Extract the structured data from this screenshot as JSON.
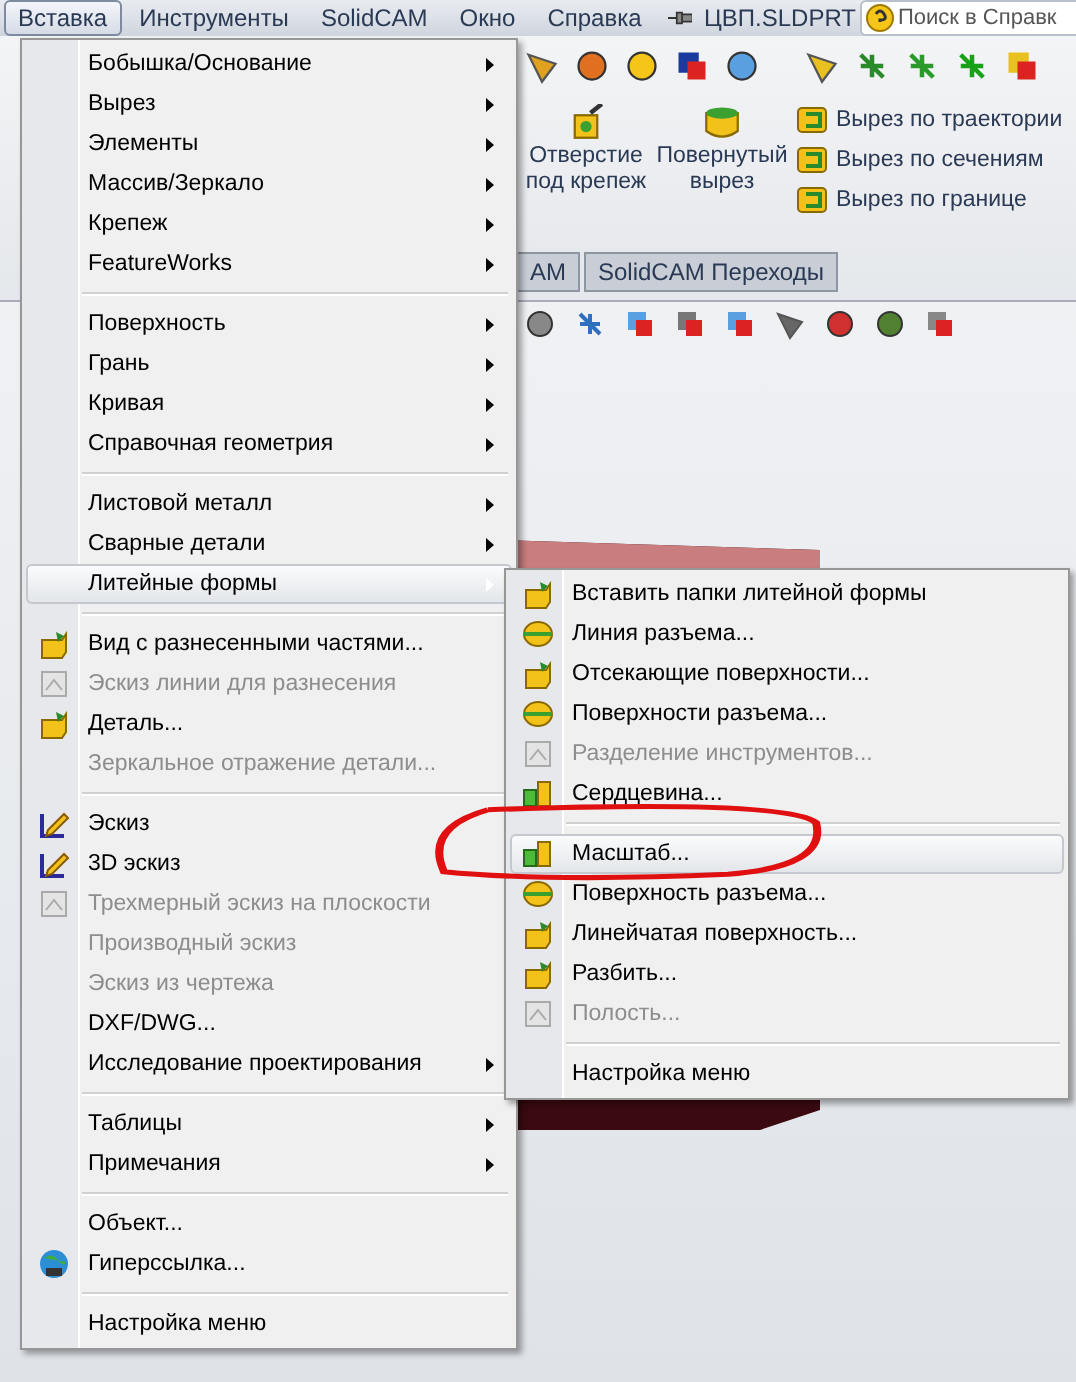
{
  "menubar": {
    "items": [
      {
        "label": "Вставка",
        "selected": true
      },
      {
        "label": "Инструменты",
        "selected": false
      },
      {
        "label": "SolidCAM",
        "selected": false
      },
      {
        "label": "Окно",
        "selected": false
      },
      {
        "label": "Справка",
        "selected": false
      }
    ]
  },
  "document_title": "ЦВП.SLDPRT",
  "search": {
    "placeholder": "Поиск в Справк"
  },
  "ribbon": {
    "buttons": [
      "Отверстие под крепеж",
      "Повернутый вырез"
    ],
    "cut_commands": [
      "Вырез по траектории",
      "Вырез по сечениям",
      "Вырез по границе"
    ]
  },
  "tabs": [
    "AM",
    "SolidCAM Переходы"
  ],
  "menu": {
    "groups": [
      [
        {
          "label": "Бобышка/Основание",
          "submenu": true,
          "disabled": false,
          "selected": false
        },
        {
          "label": "Вырез",
          "submenu": true,
          "disabled": false,
          "selected": false
        },
        {
          "label": "Элементы",
          "submenu": true,
          "disabled": false,
          "selected": false
        },
        {
          "label": "Массив/Зеркало",
          "submenu": true,
          "disabled": false,
          "selected": false
        },
        {
          "label": "Крепеж",
          "submenu": true,
          "disabled": false,
          "selected": false
        },
        {
          "label": "FeatureWorks",
          "submenu": true,
          "disabled": false,
          "selected": false
        }
      ],
      [
        {
          "label": "Поверхность",
          "submenu": true,
          "disabled": false,
          "selected": false
        },
        {
          "label": "Грань",
          "submenu": true,
          "disabled": false,
          "selected": false
        },
        {
          "label": "Кривая",
          "submenu": true,
          "disabled": false,
          "selected": false
        },
        {
          "label": "Справочная геометрия",
          "submenu": true,
          "disabled": false,
          "selected": false
        }
      ],
      [
        {
          "label": "Листовой металл",
          "submenu": true,
          "disabled": false,
          "selected": false
        },
        {
          "label": "Сварные детали",
          "submenu": true,
          "disabled": false,
          "selected": false
        },
        {
          "label": "Литейные формы",
          "submenu": true,
          "disabled": false,
          "selected": true
        }
      ],
      [
        {
          "label": "Вид с разнесенными частями...",
          "submenu": false,
          "disabled": false,
          "selected": false
        },
        {
          "label": "Эскиз линии для разнесения",
          "submenu": false,
          "disabled": true,
          "selected": false
        },
        {
          "label": "Деталь...",
          "submenu": false,
          "disabled": false,
          "selected": false
        },
        {
          "label": "Зеркальное отражение детали...",
          "submenu": false,
          "disabled": true,
          "selected": false
        }
      ],
      [
        {
          "label": "Эскиз",
          "submenu": false,
          "disabled": false,
          "selected": false
        },
        {
          "label": "3D эскиз",
          "submenu": false,
          "disabled": false,
          "selected": false
        },
        {
          "label": "Трехмерный эскиз на плоскости",
          "submenu": false,
          "disabled": true,
          "selected": false
        },
        {
          "label": "Производный эскиз",
          "submenu": false,
          "disabled": true,
          "selected": false
        },
        {
          "label": "Эскиз из чертежа",
          "submenu": false,
          "disabled": true,
          "selected": false
        },
        {
          "label": "DXF/DWG...",
          "submenu": false,
          "disabled": false,
          "selected": false
        },
        {
          "label": "Исследование проектирования",
          "submenu": true,
          "disabled": false,
          "selected": false
        }
      ],
      [
        {
          "label": "Таблицы",
          "submenu": true,
          "disabled": false,
          "selected": false
        },
        {
          "label": "Примечания",
          "submenu": true,
          "disabled": false,
          "selected": false
        }
      ],
      [
        {
          "label": "Объект...",
          "submenu": false,
          "disabled": false,
          "selected": false
        },
        {
          "label": "Гиперссылка...",
          "submenu": false,
          "disabled": false,
          "selected": false
        }
      ],
      [
        {
          "label": "Настройка меню",
          "submenu": false,
          "disabled": false,
          "selected": false
        }
      ]
    ]
  },
  "submenu": {
    "groups": [
      [
        {
          "label": "Вставить папки литейной формы",
          "disabled": false,
          "selected": false
        },
        {
          "label": "Линия разъема...",
          "disabled": false,
          "selected": false
        },
        {
          "label": "Отсекающие поверхности...",
          "disabled": false,
          "selected": false
        },
        {
          "label": "Поверхности разъема...",
          "disabled": false,
          "selected": false
        },
        {
          "label": "Разделение инструментов...",
          "disabled": true,
          "selected": false
        },
        {
          "label": "Сердцевина...",
          "disabled": false,
          "selected": false
        }
      ],
      [
        {
          "label": "Масштаб...",
          "disabled": false,
          "selected": true
        },
        {
          "label": "Поверхность разъема...",
          "disabled": false,
          "selected": false
        },
        {
          "label": "Линейчатая поверхность...",
          "disabled": false,
          "selected": false
        },
        {
          "label": "Разбить...",
          "disabled": false,
          "selected": false
        },
        {
          "label": "Полость...",
          "disabled": true,
          "selected": false
        }
      ],
      [
        {
          "label": "Настройка меню",
          "disabled": false,
          "selected": false
        }
      ]
    ]
  }
}
